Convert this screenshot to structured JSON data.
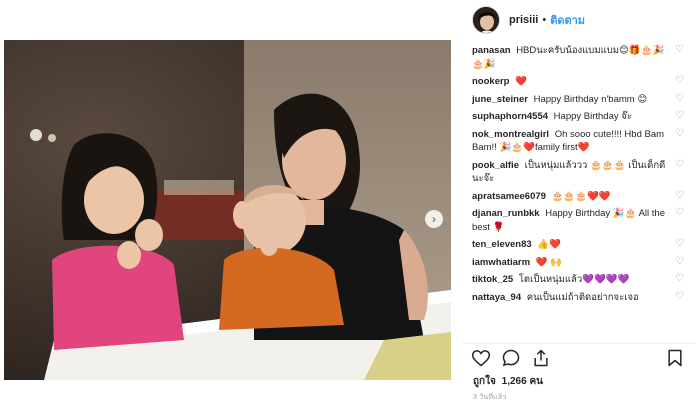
{
  "post": {
    "username": "prisiii",
    "separator": "•",
    "follow_label": "ติดตาม",
    "likes_label": "ถูกใจ",
    "likes_count": "1,266",
    "likes_unit": "คน",
    "timestamp": "3 วันที่แล้ว",
    "next_arrow": "›"
  },
  "comments": [
    {
      "author": "panasan",
      "text": "HBDนะครับน้องแบมแบม😊🎁🎂🎉🎂🎉"
    },
    {
      "author": "nookerp",
      "text": "❤️"
    },
    {
      "author": "june_steiner",
      "text": "Happy Birthday n'bamm 😊"
    },
    {
      "author": "suphaphorn4554",
      "text": "Happy Birthday จ๊ะ"
    },
    {
      "author": "nok_montrealgirl",
      "text": "Oh sooo cute!!!! Hbd Bam Bam!! 🎉🎂❤️family first❤️"
    },
    {
      "author": "pook_alfie",
      "text": "เป็นหนุ่มแล้ววว 🎂🎂🎂 เป็นเด็กดีนะจ๊ะ"
    },
    {
      "author": "apratsamee6079",
      "text": "🎂🎂🎂❤️❤️"
    },
    {
      "author": "djanan_runbkk",
      "text": "Happy Birthday 🎉🎂 All the best 🌹"
    },
    {
      "author": "ten_eleven83",
      "text": "👍❤️"
    },
    {
      "author": "iamwhatiarm",
      "text": "❤️ 🙌"
    },
    {
      "author": "tiktok_25",
      "text": "โตเป็นหนุ่มแล้ว💜💜💜💜"
    },
    {
      "author": "nattaya_94",
      "text": "คนเป็นแม่ถ้าติดอย่ากจะเจอ"
    }
  ],
  "icons": {
    "like": "heart-outline-icon",
    "comment": "speech-bubble-icon",
    "share": "share-icon",
    "save": "bookmark-icon",
    "comment_like": "small-heart-icon"
  }
}
